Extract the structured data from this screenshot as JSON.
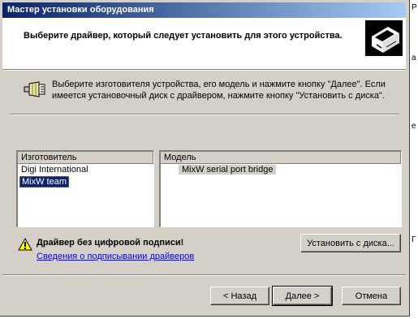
{
  "window": {
    "title": "Мастер установки оборудования"
  },
  "header": {
    "text": "Выберите драйвер, который следует установить для этого устройства."
  },
  "instruction": "Выберите изготовителя устройства, его модель и нажмите кнопку \"Далее\". Если имеется установочный диск с  драйвером, нажмите кнопку \"Установить с диска\".",
  "manufacturers": {
    "header": "Изготовитель",
    "items": [
      "Digi International",
      "MixW team"
    ],
    "selected": "MixW team"
  },
  "models": {
    "header": "Модель",
    "items": [
      "MixW serial port bridge"
    ]
  },
  "warning": {
    "text": "Драйвер без цифровой подписи!",
    "link": "Сведения о подписывании драйверов"
  },
  "buttons": {
    "have_disk": "Установить с диска...",
    "back": "< Назад",
    "next": "Далее >",
    "cancel": "Отмена"
  },
  "background": {
    "chars": [
      "Р",
      "а",
      "е",
      "Г"
    ]
  }
}
